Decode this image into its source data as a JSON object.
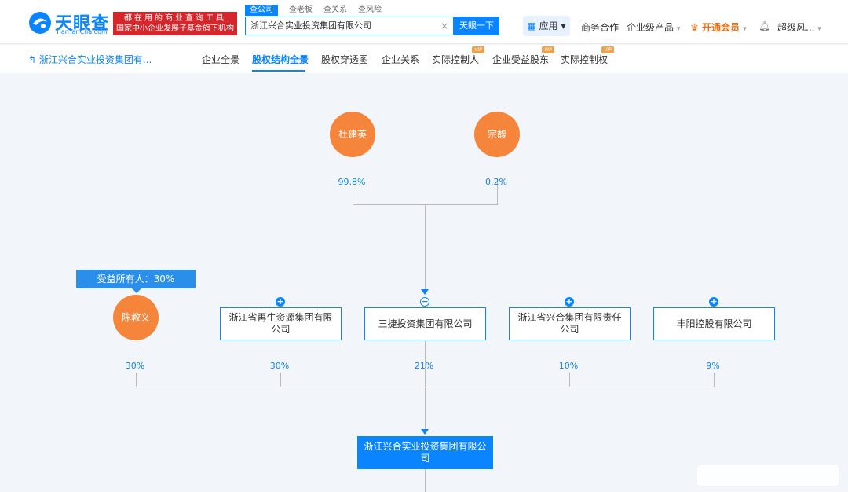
{
  "header": {
    "logo_text": "天眼查",
    "logo_sub": "TianYanCha.com",
    "slogan_line1": "都在用的商业查询工具",
    "slogan_line2": "国家中小企业发展子基金旗下机构",
    "search_tabs": [
      "查公司",
      "查老板",
      "查关系",
      "查风险"
    ],
    "search_value": "浙江兴合实业投资集团有限公司",
    "search_clear": "×",
    "search_button": "天眼一下",
    "app_button": "应用",
    "nav": [
      "商务合作",
      "企业级产品",
      "开通会员",
      "超级风..."
    ]
  },
  "subnav": {
    "back_label": "浙江兴合实业投资集团有...",
    "tabs": [
      "企业全景",
      "股权结构全景",
      "股权穿透图",
      "企业关系",
      "实际控制人",
      "企业受益股东",
      "实际控制权"
    ],
    "vip_badge": "VIP"
  },
  "graph": {
    "top_persons": [
      {
        "name": "杜建英",
        "pct": "99.8%"
      },
      {
        "name": "宗馥",
        "pct": "0.2%"
      }
    ],
    "tooltip": "受益所有人：30%",
    "shareholders": [
      {
        "name": "陈教义",
        "pct": "30%",
        "kind": "person"
      },
      {
        "name": "浙江省再生资源集团有限公司",
        "pct": "30%",
        "kind": "company"
      },
      {
        "name": "三捷投资集团有限公司",
        "pct": "21%",
        "kind": "company"
      },
      {
        "name": "浙江省兴合集团有限责任公司",
        "pct": "10%",
        "kind": "company"
      },
      {
        "name": "丰阳控股有限公司",
        "pct": "9%",
        "kind": "company"
      }
    ],
    "target": "浙江兴合实业投资集团有限公司"
  },
  "colors": {
    "brand": "#0a84ff",
    "person": "#f5853a",
    "slogan": "#d7262b"
  }
}
